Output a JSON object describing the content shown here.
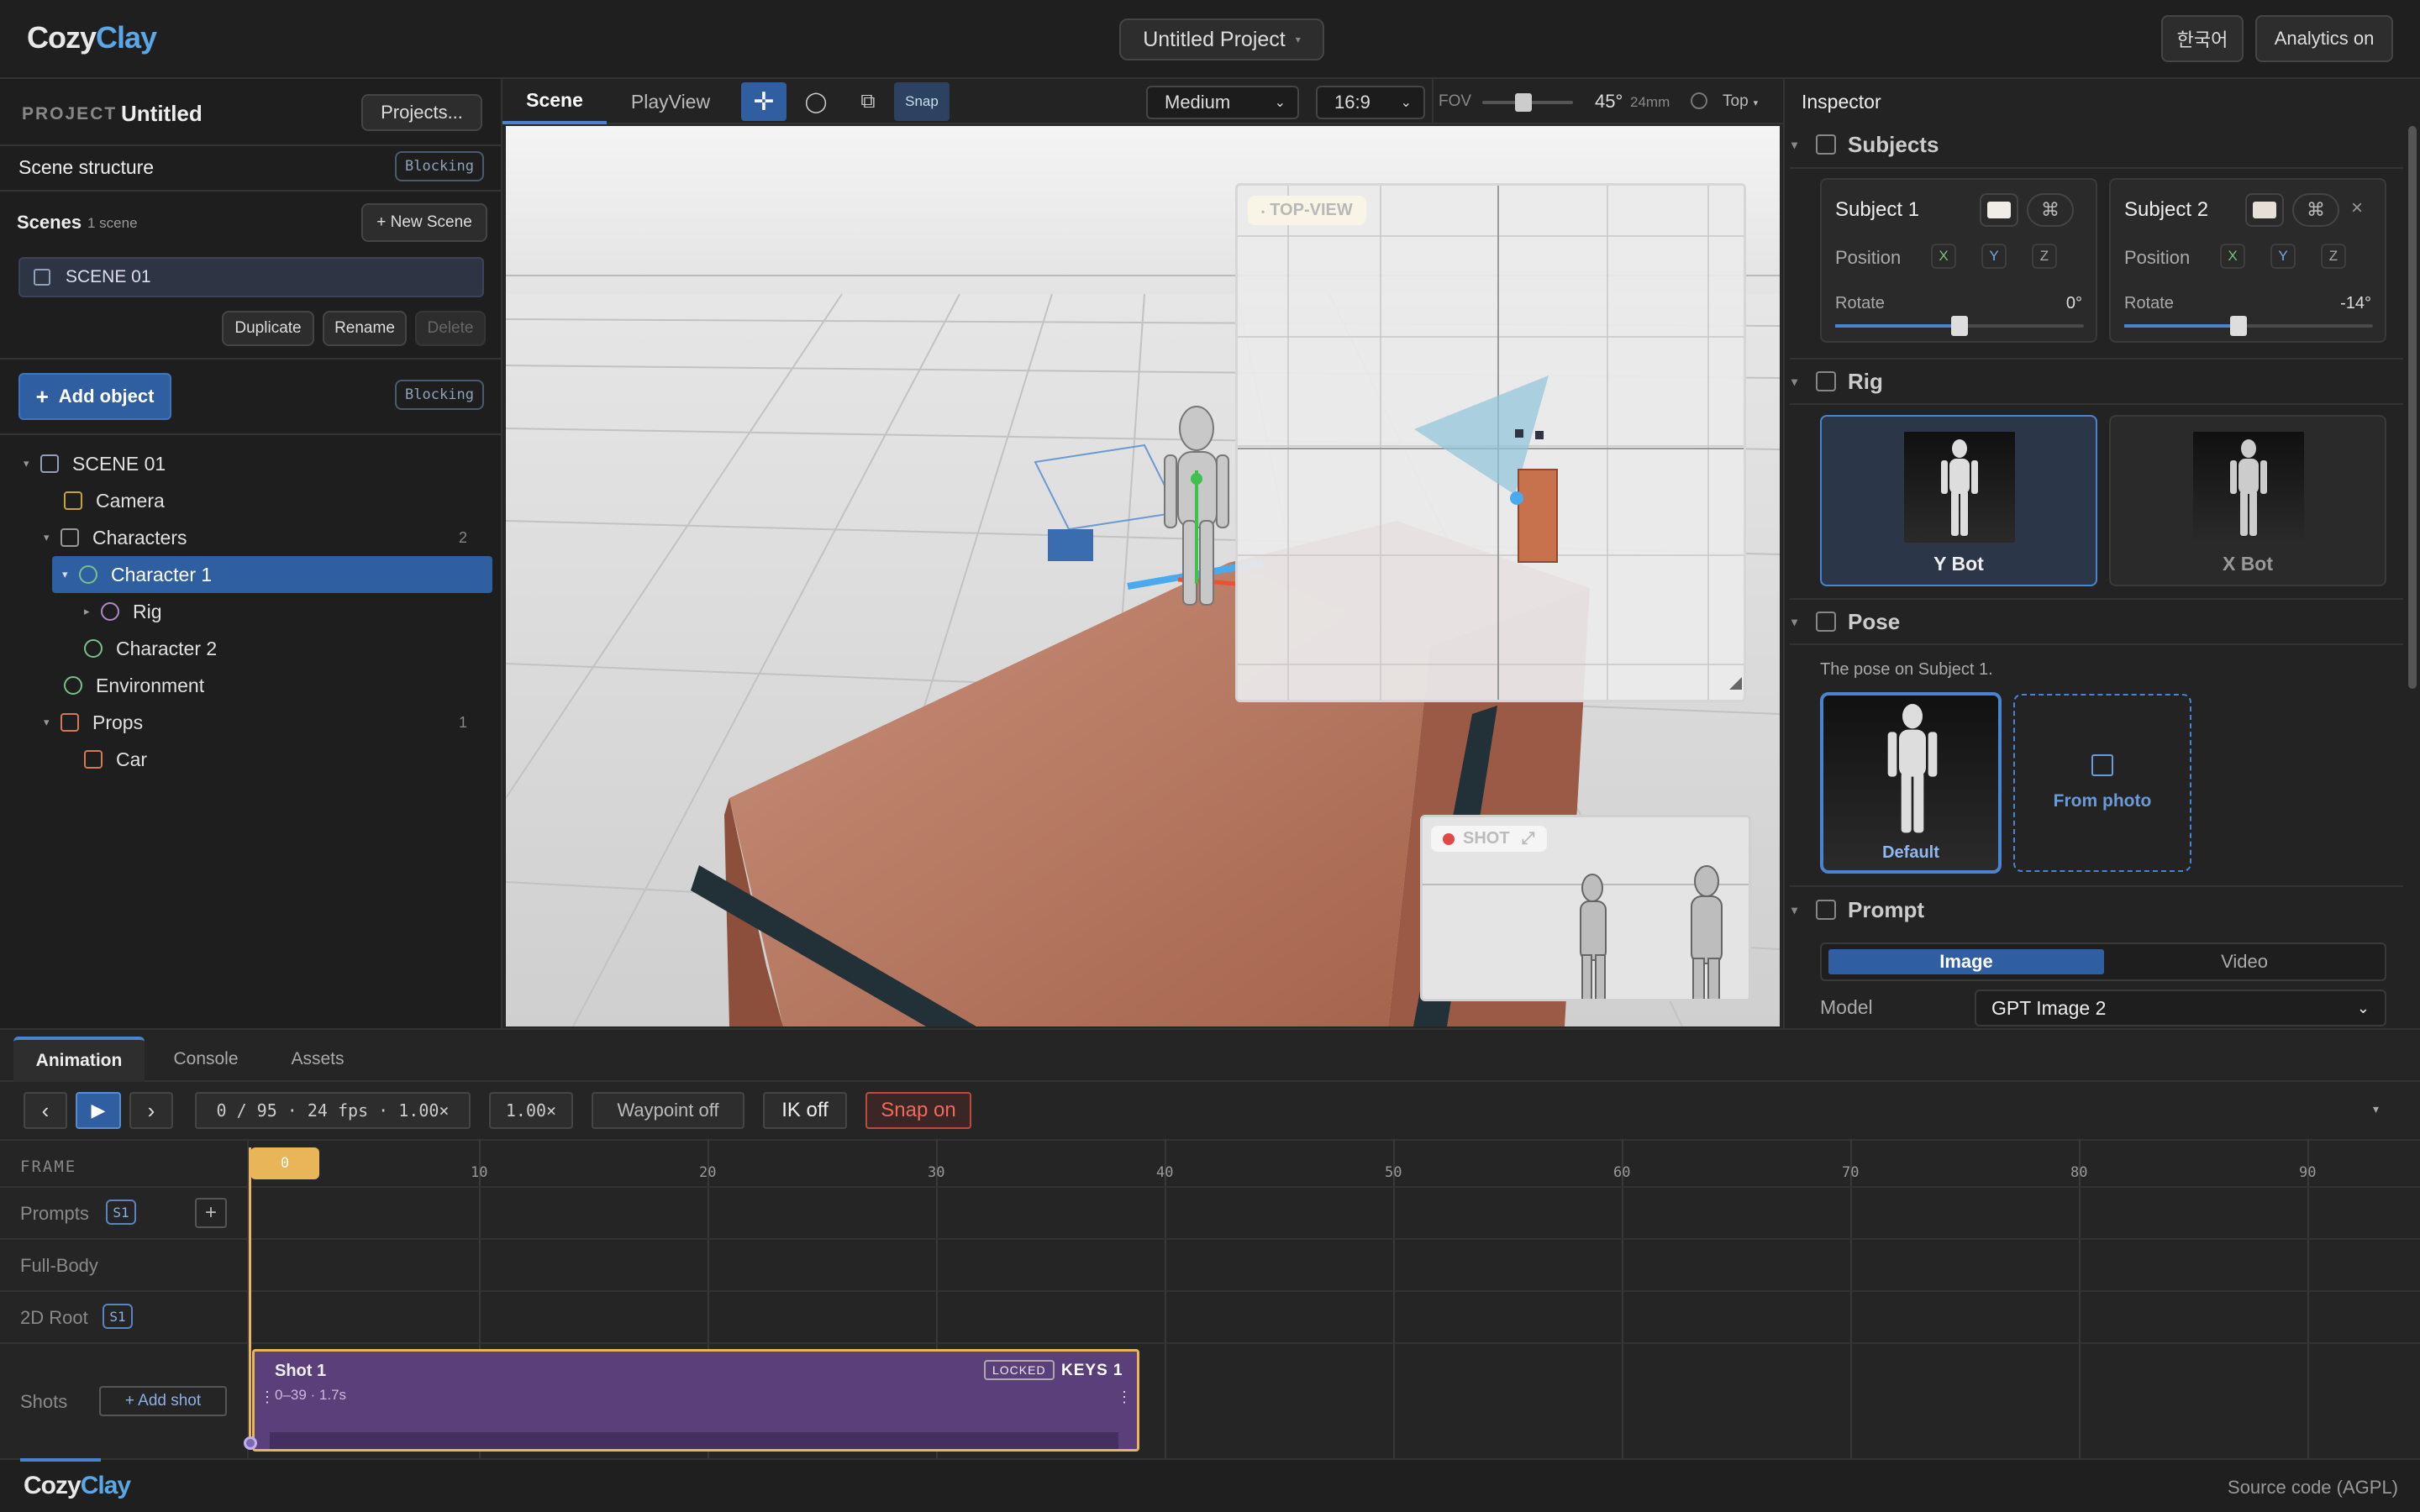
{
  "header": {
    "logo_a": "Cozy",
    "logo_b": "Clay",
    "project_title": "Untitled Project",
    "lang_button": "한국어",
    "analytics_button": "Analytics on"
  },
  "left": {
    "project_label": "PROJECT",
    "project_name": "Untitled",
    "projects_button": "Projects...",
    "scene_structure": "Scene structure",
    "blocking": "Blocking",
    "scenes_label": "Scenes",
    "scenes_count": "1 scene",
    "new_scene": "+ New Scene",
    "scene_item": "SCENE 01",
    "duplicate": "Duplicate",
    "rename": "Rename",
    "delete": "Delete",
    "add_object": "Add object",
    "tree": {
      "scene": "SCENE 01",
      "camera": "Camera",
      "characters": "Characters",
      "characters_count": "2",
      "character1": "Character 1",
      "rig": "Rig",
      "character2": "Character 2",
      "environment": "Environment",
      "props": "Props",
      "props_count": "1",
      "car": "Car"
    }
  },
  "viewport_toolbar": {
    "tab_scene": "Scene",
    "tab_playview": "PlayView",
    "snap": "Snap",
    "quality": "Medium",
    "aspect": "16:9",
    "fov_label": "FOV",
    "fov_value": "45°",
    "focal": "24mm",
    "view": "Top",
    "fov_level": 0.45
  },
  "viewport": {
    "top_view_label": "TOP-VIEW",
    "shot_label": "SHOT"
  },
  "inspector": {
    "title": "Inspector",
    "subjects": "Subjects",
    "subject1": {
      "name": "Subject 1",
      "position": "Position",
      "x": "X",
      "y": "Y",
      "z": "Z",
      "rotate": "Rotate",
      "rotate_value": "0°"
    },
    "subject2": {
      "name": "Subject 2",
      "position": "Position",
      "x": "X",
      "y": "Y",
      "z": "Z",
      "rotate": "Rotate",
      "rotate_value": "-14°"
    },
    "rig": "Rig",
    "ybot": "Y Bot",
    "xbot": "X Bot",
    "pose": "Pose",
    "pose_desc": "The pose on Subject 1.",
    "pose_default": "Default",
    "from_photo": "From photo",
    "prompt": "Prompt",
    "image": "Image",
    "video": "Video",
    "model_label": "Model",
    "model_value": "GPT Image 2"
  },
  "bottom": {
    "tab_animation": "Animation",
    "tab_console": "Console",
    "tab_assets": "Assets",
    "frame_info": "0 / 95 · 24 fps · 1.00×",
    "speed": "1.00×",
    "waypoint": "Waypoint off",
    "ik": "IK off",
    "snap": "Snap on",
    "frame_label": "FRAME",
    "playhead": "0",
    "ticks": [
      "10",
      "20",
      "30",
      "40",
      "50",
      "60",
      "70",
      "80",
      "90"
    ],
    "rows": {
      "prompts": "Prompts",
      "s1": "S1",
      "fullbody": "Full-Body",
      "root2d": "2D Root",
      "s1b": "S1",
      "shots": "Shots",
      "add_shot": "+ Add shot"
    },
    "shot": {
      "name": "Shot 1",
      "range": "0–39 · 1.7s",
      "locked": "LOCKED",
      "keys": "KEYS 1"
    }
  },
  "footer": {
    "logo_a": "Cozy",
    "logo_b": "Clay",
    "source": "Source code (AGPL)"
  },
  "colors": {
    "accent": "#2f5fa0",
    "logo_blue": "#5aa6e6",
    "playhead": "#e8b558",
    "shot_fill": "#5a3f7a",
    "snap_red": "#e05a4a"
  }
}
